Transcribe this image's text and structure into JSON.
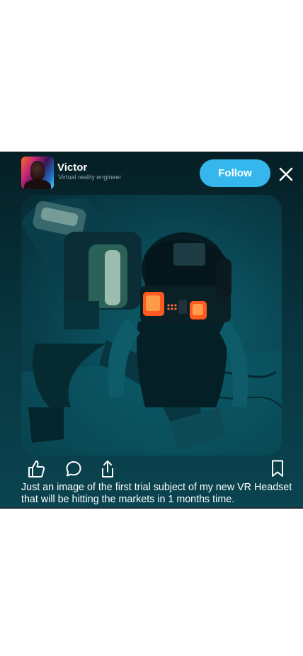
{
  "post": {
    "user": {
      "name": "Victor",
      "title": "Virtual reality engineer"
    },
    "follow_label": "Follow",
    "caption": "Just an image of the first trial subject of my new VR Headset that will be hitting the markets in 1 months time."
  },
  "icons": {
    "close": "close-icon",
    "like": "thumbs-up-icon",
    "comment": "comment-icon",
    "share": "share-icon",
    "bookmark": "bookmark-icon"
  },
  "colors": {
    "post_background": "#06242b",
    "follow_button": "#35b7ee",
    "text": "#ffffff"
  }
}
